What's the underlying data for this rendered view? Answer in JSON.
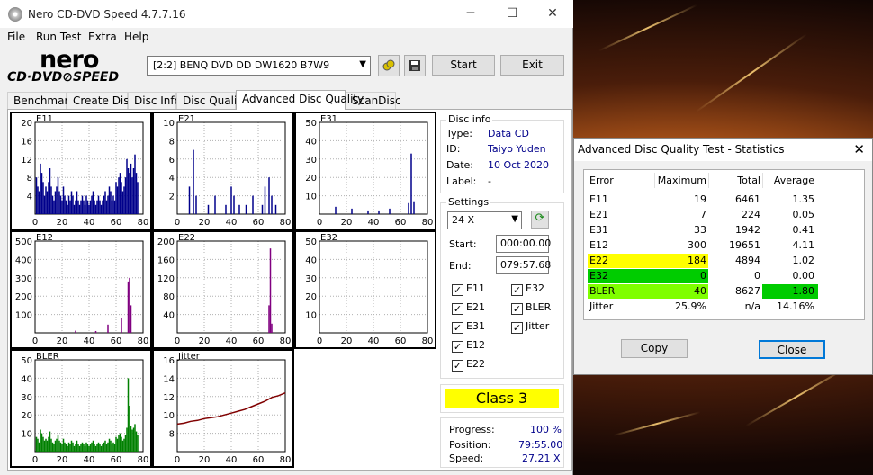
{
  "window": {
    "title": "Nero CD-DVD Speed 4.7.7.16",
    "minimize_glyph": "─",
    "maximize_glyph": "☐",
    "close_glyph": "✕"
  },
  "menu": [
    "File",
    "Run Test",
    "Extra",
    "Help"
  ],
  "logo": {
    "brand": "nero",
    "sub": "CD·DVD⊘SPEED"
  },
  "drive": {
    "selected": "[2:2]   BENQ DVD DD DW1620 B7W9"
  },
  "toolbar": {
    "start_label": "Start",
    "exit_label": "Exit",
    "eject_icon": "eject-icon",
    "save_icon": "save-icon"
  },
  "tabs": [
    "Benchmark",
    "Create Disc",
    "Disc Info",
    "Disc Quality",
    "Advanced Disc Quality",
    "ScanDisc"
  ],
  "active_tab": "Advanced Disc Quality",
  "disc_info": {
    "title": "Disc info",
    "type_label": "Type:",
    "type_value": "Data CD",
    "id_label": "ID:",
    "id_value": "Taiyo Yuden",
    "date_label": "Date:",
    "date_value": "10 Oct 2020",
    "label_label": "Label:",
    "label_value": "-"
  },
  "settings": {
    "title": "Settings",
    "speed": "24 X",
    "start_label": "Start:",
    "start_value": "000:00.00",
    "end_label": "End:",
    "end_value": "079:57.68",
    "checks": [
      {
        "label": "E11",
        "checked": true
      },
      {
        "label": "E32",
        "checked": true
      },
      {
        "label": "E21",
        "checked": true
      },
      {
        "label": "BLER",
        "checked": true
      },
      {
        "label": "E31",
        "checked": true
      },
      {
        "label": "Jitter",
        "checked": true
      },
      {
        "label": "E12",
        "checked": true
      },
      {
        "label": "E22",
        "checked": true
      }
    ],
    "check_mark": "✓"
  },
  "result": {
    "class_label": "Class 3",
    "class_color": "#ffff00"
  },
  "progress": {
    "progress_label": "Progress:",
    "progress_value": "100 %",
    "position_label": "Position:",
    "position_value": "79:55.00",
    "speed_label": "Speed:",
    "speed_value": "27.21 X"
  },
  "chart_data": [
    {
      "type": "bar",
      "name": "E11",
      "xlim": [
        0,
        80
      ],
      "ylim": [
        0,
        20
      ],
      "xticks": [
        "0",
        "20",
        "40",
        "60",
        "80"
      ],
      "yticks": [
        "4",
        "8",
        "12",
        "16",
        "20"
      ],
      "color": "#00008b",
      "x": [
        1,
        2,
        3,
        4,
        5,
        6,
        7,
        8,
        9,
        10,
        11,
        12,
        13,
        14,
        15,
        16,
        17,
        18,
        19,
        20,
        21,
        22,
        23,
        24,
        25,
        26,
        27,
        28,
        29,
        30,
        31,
        32,
        33,
        34,
        35,
        36,
        37,
        38,
        39,
        40,
        41,
        42,
        43,
        44,
        45,
        46,
        47,
        48,
        49,
        50,
        51,
        52,
        53,
        54,
        55,
        56,
        57,
        58,
        59,
        60,
        61,
        62,
        63,
        64,
        65,
        66,
        67,
        68,
        69,
        70,
        71,
        72,
        73,
        74,
        75,
        76
      ],
      "values": [
        8,
        6,
        5,
        11,
        9,
        7,
        4,
        6,
        5,
        7,
        10,
        6,
        4,
        3,
        5,
        6,
        8,
        5,
        4,
        3,
        6,
        4,
        3,
        2,
        4,
        3,
        5,
        4,
        2,
        3,
        5,
        3,
        2,
        3,
        4,
        3,
        2,
        4,
        3,
        2,
        3,
        4,
        5,
        3,
        2,
        3,
        4,
        3,
        2,
        3,
        4,
        5,
        3,
        4,
        6,
        5,
        3,
        4,
        3,
        7,
        6,
        8,
        9,
        7,
        5,
        6,
        8,
        12,
        10,
        9,
        11,
        8,
        10,
        13,
        9,
        7
      ]
    },
    {
      "type": "bar",
      "name": "E21",
      "xlim": [
        0,
        80
      ],
      "ylim": [
        0,
        10
      ],
      "xticks": [
        "0",
        "20",
        "40",
        "60",
        "80"
      ],
      "yticks": [
        "2",
        "4",
        "6",
        "8",
        "10"
      ],
      "color": "#00008b",
      "x": [
        9,
        12,
        14,
        23,
        28,
        36,
        40,
        42,
        46,
        51,
        56,
        63,
        65,
        68,
        70,
        73
      ],
      "values": [
        3,
        7,
        2,
        1,
        2,
        1,
        3,
        2,
        1,
        1,
        2,
        1,
        3,
        4,
        2,
        1
      ]
    },
    {
      "type": "bar",
      "name": "E31",
      "xlim": [
        0,
        80
      ],
      "ylim": [
        0,
        50
      ],
      "xticks": [
        "0",
        "20",
        "40",
        "60",
        "80"
      ],
      "yticks": [
        "10",
        "20",
        "30",
        "40",
        "50"
      ],
      "color": "#00008b",
      "x": [
        12,
        24,
        36,
        44,
        52,
        66,
        68,
        70
      ],
      "values": [
        4,
        3,
        2,
        2,
        3,
        6,
        33,
        7
      ]
    },
    {
      "type": "bar",
      "name": "E12",
      "xlim": [
        0,
        80
      ],
      "ylim": [
        0,
        500
      ],
      "xticks": [
        "0",
        "20",
        "40",
        "60",
        "80"
      ],
      "yticks": [
        "100",
        "200",
        "300",
        "400",
        "500"
      ],
      "color": "#800080",
      "x": [
        30,
        45,
        54,
        64,
        69,
        70,
        71
      ],
      "values": [
        12,
        10,
        45,
        80,
        280,
        300,
        150
      ]
    },
    {
      "type": "bar",
      "name": "E22",
      "xlim": [
        0,
        80
      ],
      "ylim": [
        0,
        200
      ],
      "xticks": [
        "0",
        "20",
        "40",
        "60",
        "80"
      ],
      "yticks": [
        "40",
        "80",
        "120",
        "160",
        "200"
      ],
      "color": "#800080",
      "x": [
        68,
        69,
        70
      ],
      "values": [
        60,
        184,
        20
      ]
    },
    {
      "type": "bar",
      "name": "E32",
      "xlim": [
        0,
        80
      ],
      "ylim": [
        0,
        50
      ],
      "xticks": [
        "0",
        "20",
        "40",
        "60",
        "80"
      ],
      "yticks": [
        "10",
        "20",
        "30",
        "40",
        "50"
      ],
      "color": "#800080",
      "x": [],
      "values": []
    },
    {
      "type": "bar",
      "name": "BLER",
      "xlim": [
        0,
        80
      ],
      "ylim": [
        0,
        50
      ],
      "xticks": [
        "0",
        "20",
        "40",
        "60",
        "80"
      ],
      "yticks": [
        "10",
        "20",
        "30",
        "40",
        "50"
      ],
      "color": "#008000",
      "x": [
        1,
        2,
        3,
        4,
        5,
        6,
        7,
        8,
        9,
        10,
        11,
        12,
        13,
        14,
        15,
        16,
        17,
        18,
        19,
        20,
        21,
        22,
        23,
        24,
        25,
        26,
        27,
        28,
        29,
        30,
        31,
        32,
        33,
        34,
        35,
        36,
        37,
        38,
        39,
        40,
        41,
        42,
        43,
        44,
        45,
        46,
        47,
        48,
        49,
        50,
        51,
        52,
        53,
        54,
        55,
        56,
        57,
        58,
        59,
        60,
        61,
        62,
        63,
        64,
        65,
        66,
        67,
        68,
        69,
        70,
        71,
        72,
        73,
        74,
        75,
        76
      ],
      "values": [
        8,
        7,
        5,
        12,
        10,
        8,
        6,
        7,
        6,
        8,
        11,
        7,
        5,
        4,
        6,
        7,
        9,
        6,
        5,
        4,
        7,
        5,
        4,
        3,
        5,
        4,
        6,
        5,
        3,
        4,
        6,
        4,
        3,
        4,
        5,
        4,
        3,
        5,
        4,
        3,
        4,
        5,
        6,
        4,
        3,
        4,
        5,
        4,
        3,
        4,
        5,
        6,
        4,
        5,
        7,
        6,
        4,
        5,
        4,
        8,
        7,
        9,
        10,
        8,
        6,
        7,
        9,
        13,
        40,
        25,
        14,
        12,
        13,
        15,
        11,
        9
      ]
    },
    {
      "type": "line",
      "name": "Jitter",
      "xlim": [
        0,
        80
      ],
      "ylim": [
        6,
        16
      ],
      "xticks": [
        "0",
        "20",
        "40",
        "60",
        "80"
      ],
      "yticks": [
        "8",
        "10",
        "12",
        "14",
        "16"
      ],
      "color": "#800000",
      "x": [
        0,
        5,
        10,
        15,
        20,
        25,
        30,
        35,
        40,
        45,
        50,
        55,
        60,
        65,
        70,
        75,
        80
      ],
      "values": [
        9.0,
        9.1,
        9.3,
        9.4,
        9.6,
        9.7,
        9.8,
        10.0,
        10.2,
        10.4,
        10.6,
        10.9,
        11.2,
        11.5,
        11.9,
        12.1,
        12.4
      ]
    }
  ],
  "stats": {
    "title": "Advanced Disc Quality Test - Statistics",
    "close_glyph": "✕",
    "headers": [
      "Error",
      "Maximum",
      "Total",
      "Average"
    ],
    "rows": [
      {
        "name": "E11",
        "max": "19",
        "total": "6461",
        "avg": "1.35",
        "hl": "",
        "avg_hl": ""
      },
      {
        "name": "E21",
        "max": "7",
        "total": "224",
        "avg": "0.05",
        "hl": "",
        "avg_hl": ""
      },
      {
        "name": "E31",
        "max": "33",
        "total": "1942",
        "avg": "0.41",
        "hl": "",
        "avg_hl": ""
      },
      {
        "name": "E12",
        "max": "300",
        "total": "19651",
        "avg": "4.11",
        "hl": "",
        "avg_hl": ""
      },
      {
        "name": "E22",
        "max": "184",
        "total": "4894",
        "avg": "1.02",
        "hl": "#ffff00",
        "avg_hl": ""
      },
      {
        "name": "E32",
        "max": "0",
        "total": "0",
        "avg": "0.00",
        "hl": "#00cc00",
        "avg_hl": ""
      },
      {
        "name": "BLER",
        "max": "40",
        "total": "8627",
        "avg": "1.80",
        "hl": "#7fff00",
        "avg_hl": "#00cc00"
      },
      {
        "name": "Jitter",
        "max": "25.9%",
        "total": "n/a",
        "avg": "14.16%",
        "hl": "",
        "avg_hl": ""
      }
    ],
    "copy_label": "Copy",
    "close_label": "Close"
  }
}
